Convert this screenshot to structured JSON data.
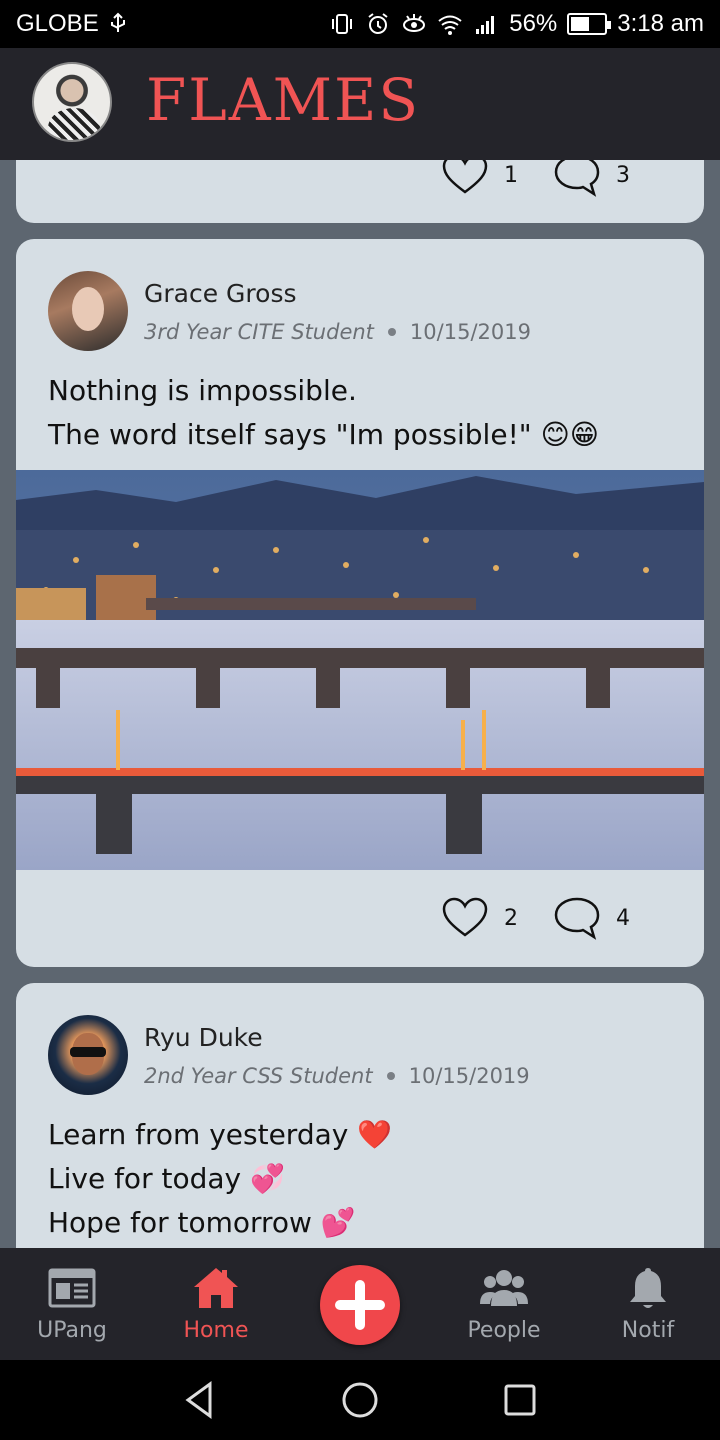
{
  "status_bar": {
    "carrier": "GLOBE",
    "battery": "56%",
    "battery_level": 0.56,
    "time": "3:18 am",
    "icons": [
      "usb-icon",
      "vibrate-icon",
      "alarm-icon",
      "eye-comfort-icon",
      "wifi-icon",
      "signal-icon",
      "battery-icon"
    ]
  },
  "app_bar": {
    "title": "FLAMES"
  },
  "feed": {
    "top_card": {
      "likes": "1",
      "comments": "3"
    },
    "posts": [
      {
        "author": "Grace Gross",
        "role": "3rd Year CITE Student",
        "date": "10/15/2019",
        "lines": [
          "Nothing is impossible.",
          "The word itself says \"Im possible!\" 😊😁"
        ],
        "likes": "2",
        "comments": "4"
      },
      {
        "author": "Ryu Duke",
        "role": "2nd Year CSS Student",
        "date": "10/15/2019",
        "lines": [
          "Learn from yesterday ❤️",
          "Live for today 💞",
          "Hope for tomorrow 💕"
        ]
      }
    ]
  },
  "bottom_nav": {
    "items": [
      {
        "label": "UPang",
        "icon": "newspaper-icon",
        "active": false
      },
      {
        "label": "Home",
        "icon": "home-icon",
        "active": true
      },
      {
        "label": "People",
        "icon": "people-icon",
        "active": false
      },
      {
        "label": "Notif",
        "icon": "bell-icon",
        "active": false
      }
    ],
    "fab_icon": "plus-icon"
  },
  "colors": {
    "accent": "#f05454",
    "bar_background": "#24242a",
    "card_background": "#d6dee4",
    "feed_background": "#5d6670"
  }
}
